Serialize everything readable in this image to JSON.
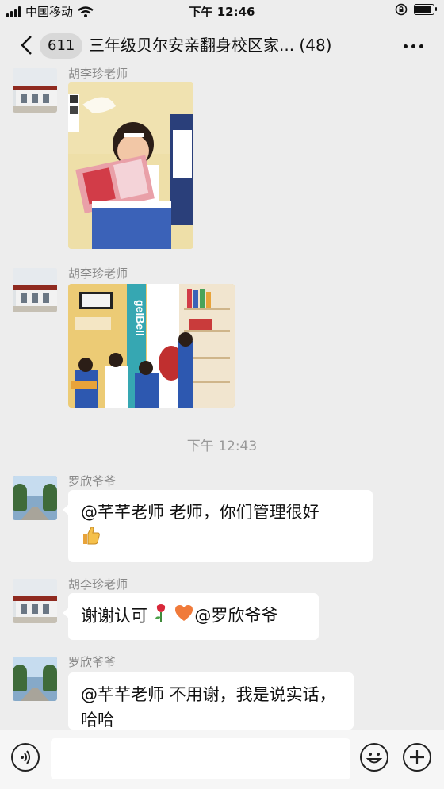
{
  "status_bar": {
    "carrier": "中国移动",
    "time": "下午 12:46"
  },
  "header": {
    "back_label": "back",
    "unread_count": "611",
    "chat_title": "三年级贝尔安亲翻身校区家... (48)"
  },
  "messages": [
    {
      "sender": "胡李珍老师",
      "type": "image"
    },
    {
      "sender": "胡李珍老师",
      "type": "image"
    },
    {
      "type": "time",
      "text": "下午 12:43"
    },
    {
      "sender": "罗欣爷爷",
      "type": "text",
      "text": "@芊芊老师 老师，你们管理很好",
      "emoji": "thumbs-up"
    },
    {
      "sender": "胡李珍老师",
      "type": "text",
      "text_before": "谢谢认可",
      "emoji": [
        "rose",
        "orange-heart"
      ],
      "text_after": "@罗欣爷爷"
    },
    {
      "sender": "罗欣爷爷",
      "type": "text",
      "text": "@芊芊老师 不用谢，我是说实话，哈哈"
    }
  ],
  "input_bar": {
    "voice_icon": "voice-icon",
    "emoji_icon": "emoji-icon",
    "plus_icon": "plus-icon",
    "text_value": ""
  },
  "photo_text": {
    "sign": "gelBell"
  },
  "colors": {
    "background": "#ededed",
    "bubble": "#ffffff",
    "timestamp": "#999999"
  }
}
